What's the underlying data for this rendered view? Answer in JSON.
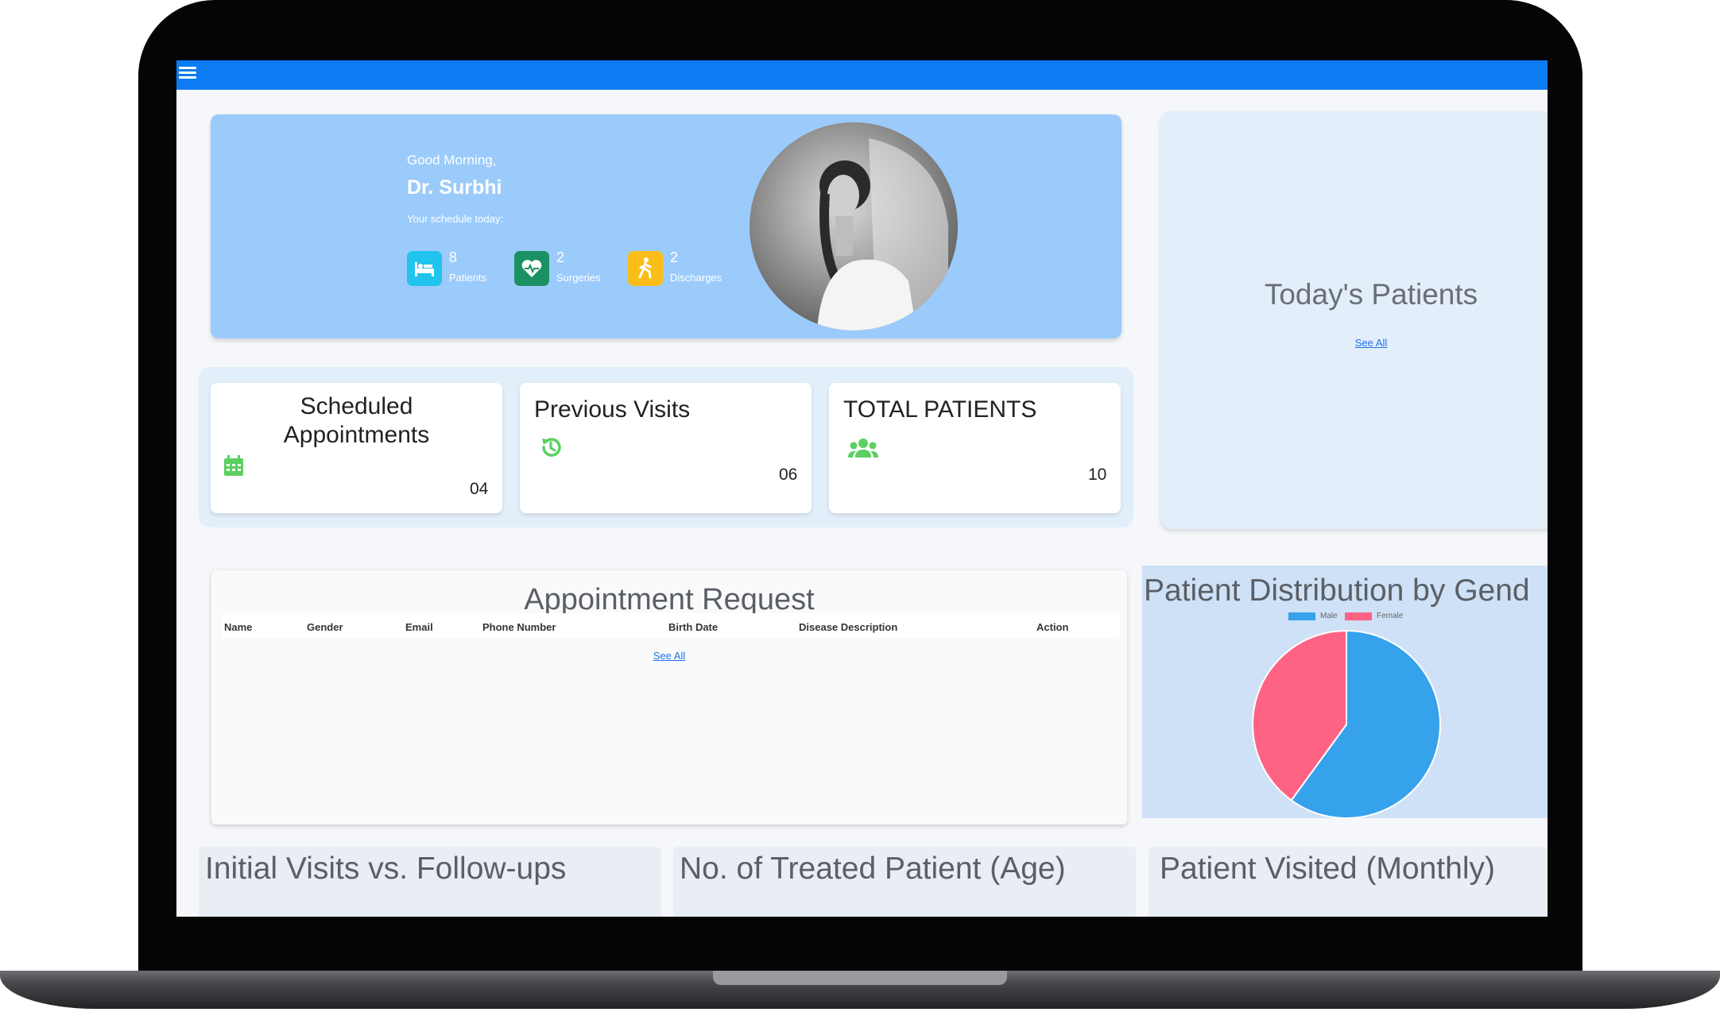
{
  "header": {
    "menu_icon": "hamburger-menu-icon",
    "color": "#0d7cf2"
  },
  "greeting": {
    "salutation": "Good Morning,",
    "doctor_name": "Dr. Surbhi",
    "schedule_label": "Your schedule today:",
    "stats": [
      {
        "value": "8",
        "label": "Patients",
        "icon": "hospital-bed-icon",
        "color": "#20c4ec"
      },
      {
        "value": "2",
        "label": "Surgeries",
        "icon": "heart-pulse-icon",
        "color": "#1b9163"
      },
      {
        "value": "2",
        "label": "Discharges",
        "icon": "walking-person-icon",
        "color": "#fbbd17"
      }
    ]
  },
  "today_patients": {
    "title": "Today's Patients",
    "link": "See All"
  },
  "summary_cards": [
    {
      "title": "Scheduled Appointments",
      "value": "04",
      "icon": "calendar-icon"
    },
    {
      "title": "Previous Visits",
      "value": "06",
      "icon": "history-icon"
    },
    {
      "title": "TOTAL PATIENTS",
      "value": "10",
      "icon": "users-icon"
    }
  ],
  "appointment_request": {
    "title": "Appointment Request",
    "columns": [
      "Name",
      "Gender",
      "Email",
      "Phone Number",
      "Birth Date",
      "Disease Description",
      "Action"
    ],
    "link": "See All"
  },
  "gender_chart": {
    "title": "Patient Distribution by Gend",
    "colors": {
      "Male": "#36a2eb",
      "Female": "#ff6384"
    }
  },
  "chart_data": {
    "type": "pie",
    "categories": [
      "Male",
      "Female"
    ],
    "values": [
      60,
      40
    ]
  },
  "bottom_cards": [
    {
      "title": "Initial Visits vs. Follow-ups"
    },
    {
      "title": "No. of Treated Patient (Age)"
    },
    {
      "title": "Patient Visited (Monthly)"
    }
  ]
}
